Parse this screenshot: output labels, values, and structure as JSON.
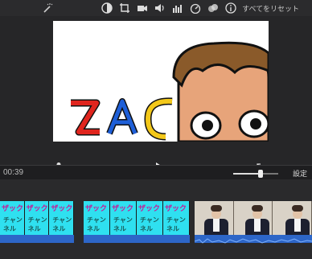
{
  "toolbar": {
    "reset_label": "すべてをリセット",
    "icons": [
      "magic-wand-icon",
      "color-palette-icon",
      "crop-icon",
      "camera-icon",
      "volume-icon",
      "equalizer-icon",
      "speed-icon",
      "overlay-icon",
      "info-icon"
    ]
  },
  "viewer": {
    "letters": [
      "Z",
      "A",
      "C"
    ]
  },
  "timebar": {
    "time": "00:39",
    "settings_label": "設定",
    "zoom_level": 0.6
  },
  "timeline": {
    "clip1_texts": [
      "ザック",
      "チャンネル"
    ],
    "clip2_texts": [
      "ザック",
      "チャンネル"
    ]
  },
  "colors": {
    "accent": "#2fe0f0",
    "audio": "#2d66c8"
  }
}
